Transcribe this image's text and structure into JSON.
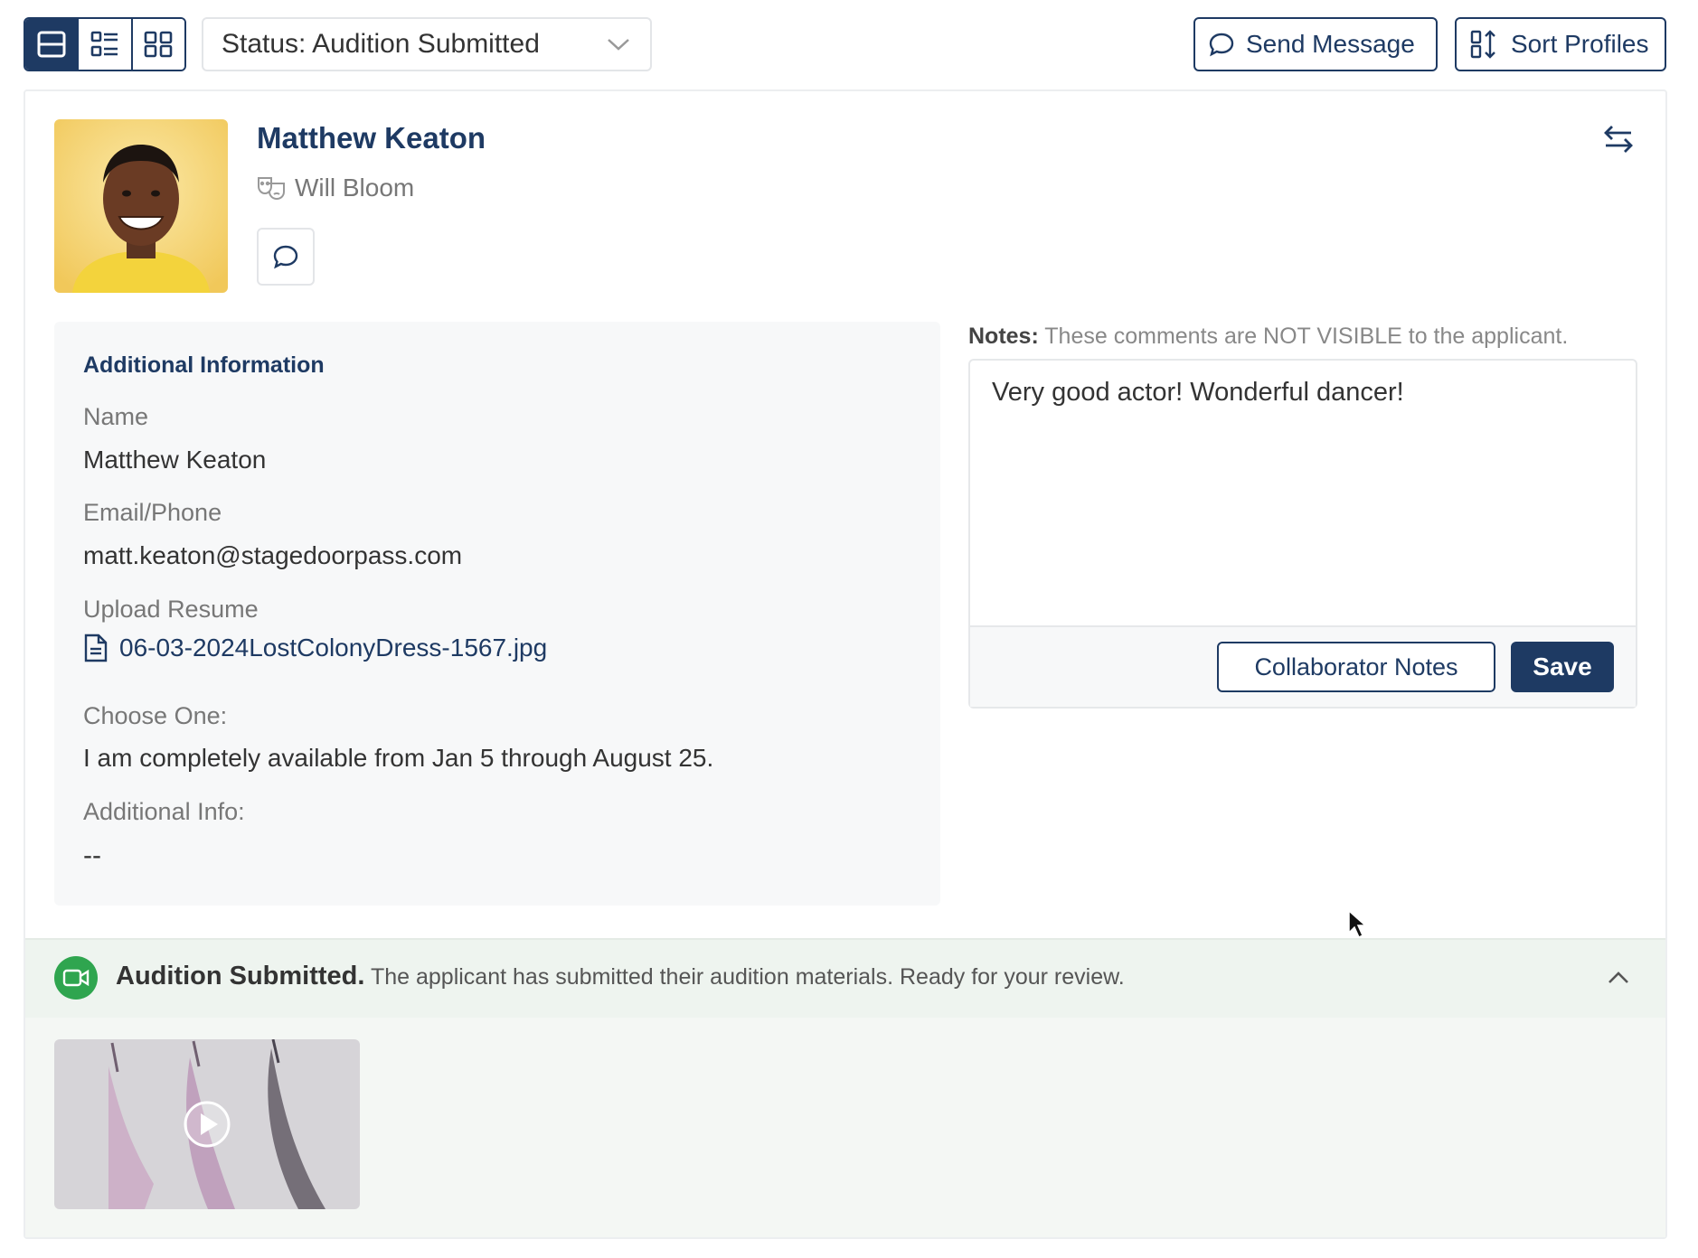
{
  "toolbar": {
    "status_label": "Status: Audition Submitted",
    "send_message": "Send Message",
    "sort_profiles": "Sort Profiles"
  },
  "profile": {
    "name": "Matthew Keaton",
    "role": "Will Bloom"
  },
  "additional_info": {
    "title": "Additional Information",
    "fields": [
      {
        "label": "Name",
        "value": "Matthew Keaton"
      },
      {
        "label": "Email/Phone",
        "value": "matt.keaton@stagedoorpass.com"
      },
      {
        "label": "Upload Resume",
        "value": "06-03-2024LostColonyDress-1567.jpg"
      },
      {
        "label": "Choose One:",
        "value": "I am completely available from Jan 5 through August 25."
      },
      {
        "label": "Additional Info:",
        "value": "--"
      }
    ]
  },
  "notes": {
    "caption_bold": "Notes:",
    "caption_rest": " These comments are NOT VISIBLE to the applicant.",
    "text": "Very good actor! Wonderful dancer!",
    "collaborator_notes": "Collaborator Notes",
    "save": "Save"
  },
  "audition": {
    "status_bold": "Audition Submitted.",
    "status_text": " The applicant has submitted their audition materials. Ready for your review."
  },
  "colors": {
    "primary": "#1e3a63",
    "success": "#2fa54f",
    "banner_bg": "#eef4ef"
  },
  "icons": {
    "view_modes": [
      "single-view-icon",
      "list-view-icon",
      "grid-view-icon"
    ],
    "send_message": "chat-bubble-icon",
    "sort_profiles": "sort-icon",
    "swap": "swap-arrows-icon",
    "role": "theater-masks-icon",
    "resume": "document-icon",
    "audition": "video-camera-icon",
    "collapse": "chevron-up-icon",
    "play": "play-icon"
  }
}
